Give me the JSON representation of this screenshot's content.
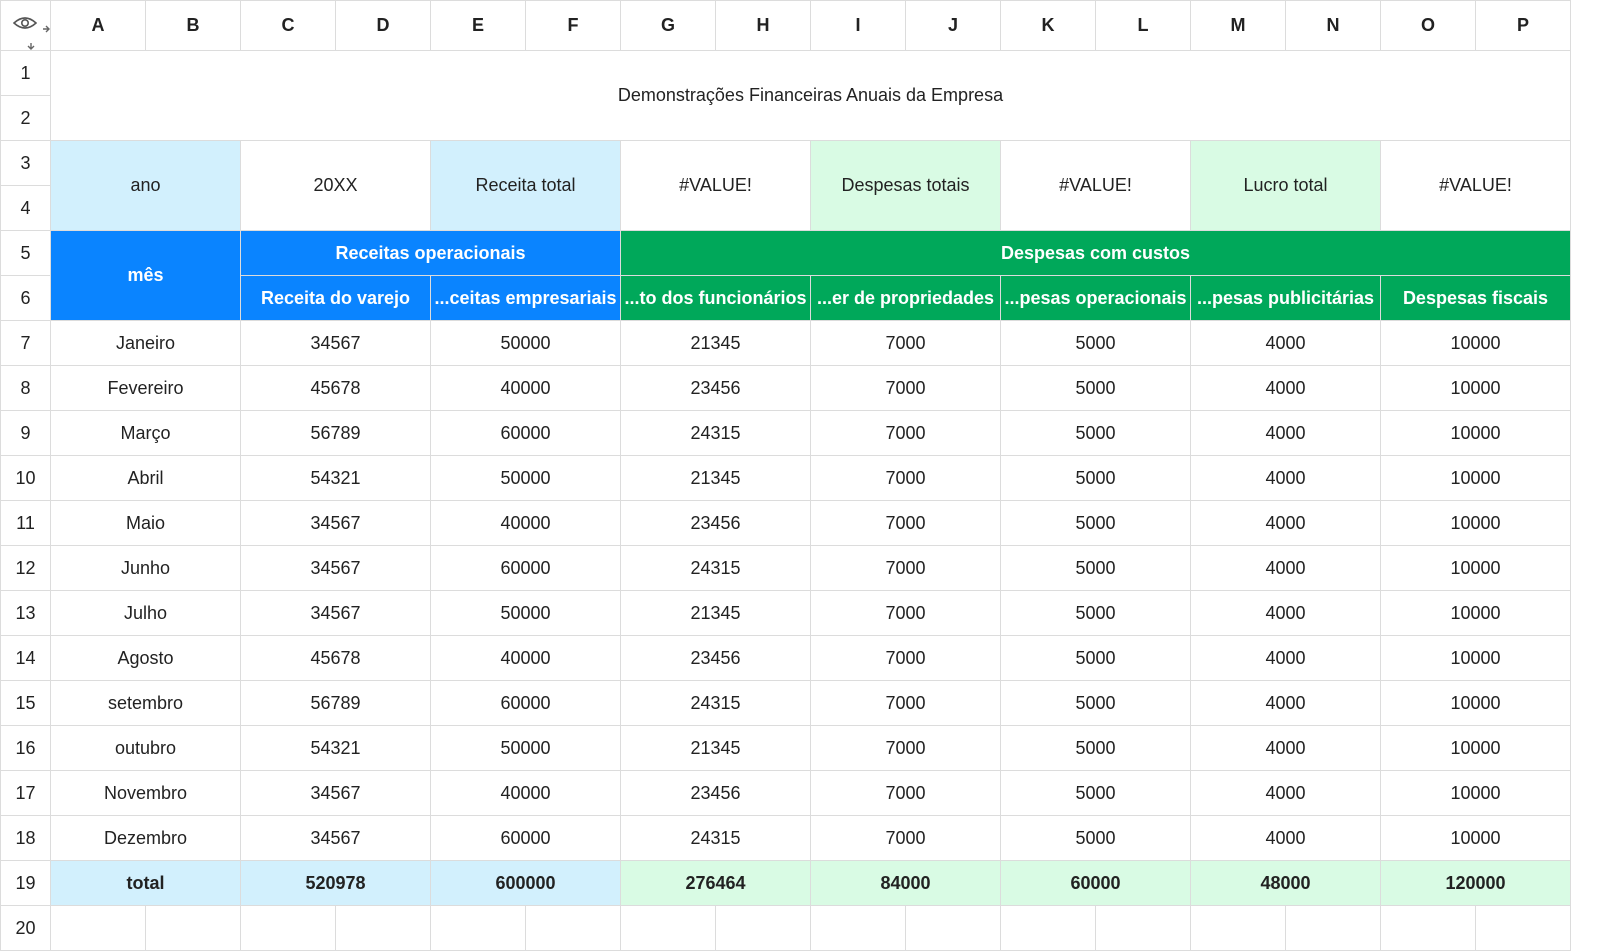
{
  "columns": [
    "A",
    "B",
    "C",
    "D",
    "E",
    "F",
    "G",
    "H",
    "I",
    "J",
    "K",
    "L",
    "M",
    "N",
    "O",
    "P"
  ],
  "rows": [
    "1",
    "2",
    "3",
    "4",
    "5",
    "6",
    "7",
    "8",
    "9",
    "10",
    "11",
    "12",
    "13",
    "14",
    "15",
    "16",
    "17",
    "18",
    "19",
    "20"
  ],
  "title": "Demonstrações Financeiras Anuais da Empresa",
  "summary": {
    "year_label": "ano",
    "year_value": "20XX",
    "revenue_label": "Receita total",
    "revenue_value": "#VALUE!",
    "expenses_label": "Despesas totais",
    "expenses_value": "#VALUE!",
    "profit_label": "Lucro total",
    "profit_value": "#VALUE!"
  },
  "header": {
    "month": "mês",
    "revenue_group": "Receitas operacionais",
    "expense_group": "Despesas com custos",
    "sub": [
      "Receita do varejo",
      "...ceitas empresariais",
      "...to dos funcionários",
      "...er de propriedades",
      "...pesas operacionais",
      "...pesas publicitárias",
      "Despesas fiscais"
    ]
  },
  "data": [
    [
      "Janeiro",
      "34567",
      "50000",
      "21345",
      "7000",
      "5000",
      "4000",
      "10000"
    ],
    [
      "Fevereiro",
      "45678",
      "40000",
      "23456",
      "7000",
      "5000",
      "4000",
      "10000"
    ],
    [
      "Março",
      "56789",
      "60000",
      "24315",
      "7000",
      "5000",
      "4000",
      "10000"
    ],
    [
      "Abril",
      "54321",
      "50000",
      "21345",
      "7000",
      "5000",
      "4000",
      "10000"
    ],
    [
      "Maio",
      "34567",
      "40000",
      "23456",
      "7000",
      "5000",
      "4000",
      "10000"
    ],
    [
      "Junho",
      "34567",
      "60000",
      "24315",
      "7000",
      "5000",
      "4000",
      "10000"
    ],
    [
      "Julho",
      "34567",
      "50000",
      "21345",
      "7000",
      "5000",
      "4000",
      "10000"
    ],
    [
      "Agosto",
      "45678",
      "40000",
      "23456",
      "7000",
      "5000",
      "4000",
      "10000"
    ],
    [
      "setembro",
      "56789",
      "60000",
      "24315",
      "7000",
      "5000",
      "4000",
      "10000"
    ],
    [
      "outubro",
      "54321",
      "50000",
      "21345",
      "7000",
      "5000",
      "4000",
      "10000"
    ],
    [
      "Novembro",
      "34567",
      "40000",
      "23456",
      "7000",
      "5000",
      "4000",
      "10000"
    ],
    [
      "Dezembro",
      "34567",
      "60000",
      "24315",
      "7000",
      "5000",
      "4000",
      "10000"
    ]
  ],
  "total": [
    "total",
    "520978",
    "600000",
    "276464",
    "84000",
    "60000",
    "48000",
    "120000"
  ],
  "colors": {
    "light_blue": "#d2f0fd",
    "light_green": "#d9fbe4",
    "blue": "#0a84ff",
    "green": "#00a85a",
    "grid": "#dcdcdc"
  },
  "icons": {
    "corner_visibility": "eye-icon",
    "freeze_columns": "freeze-columns-icon",
    "freeze_rows": "freeze-rows-icon"
  }
}
